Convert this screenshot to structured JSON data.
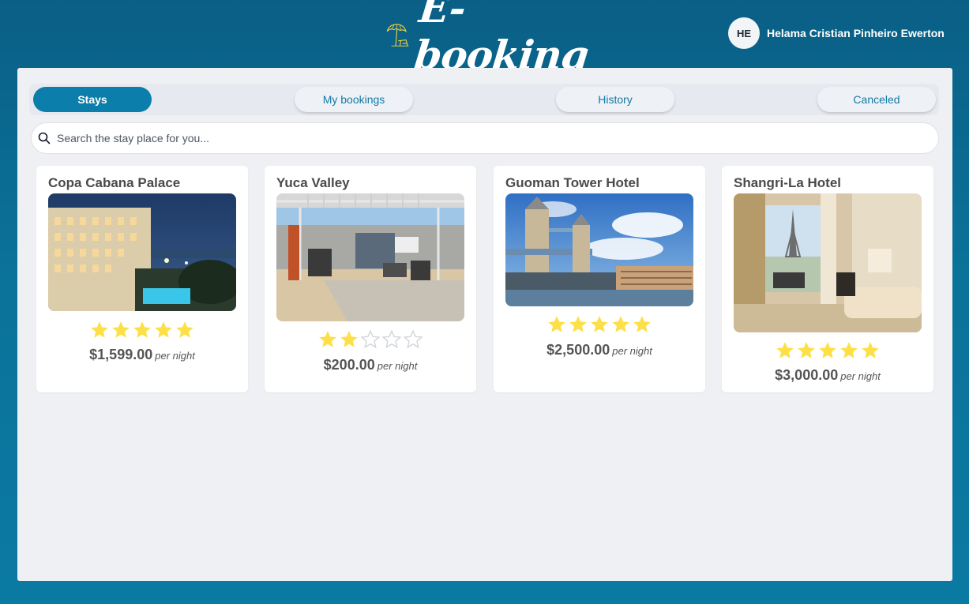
{
  "app": {
    "logo_text": "E-booking"
  },
  "user": {
    "initials": "HE",
    "name": "Helama Cristian Pinheiro Ewerton"
  },
  "tabs": [
    {
      "label": "Stays",
      "active": true
    },
    {
      "label": "My bookings",
      "active": false
    },
    {
      "label": "History",
      "active": false
    },
    {
      "label": "Canceled",
      "active": false
    }
  ],
  "search": {
    "placeholder": "Search the stay place for you...",
    "value": ""
  },
  "stays": [
    {
      "name": "Copa Cabana Palace",
      "rating": 5,
      "max_rating": 5,
      "price": "$1,599.00",
      "price_unit": "per night",
      "image": "hotel-night-pool-photo"
    },
    {
      "name": "Yuca Valley",
      "rating": 2,
      "max_rating": 5,
      "price": "$200.00",
      "price_unit": "per night",
      "image": "backyard-pergola-photo"
    },
    {
      "name": "Guoman Tower Hotel",
      "rating": 5,
      "max_rating": 5,
      "price": "$2,500.00",
      "price_unit": "per night",
      "image": "tower-bridge-photo"
    },
    {
      "name": "Shangri-La Hotel",
      "rating": 5,
      "max_rating": 5,
      "price": "$3,000.00",
      "price_unit": "per night",
      "image": "eiffel-view-room-photo"
    }
  ],
  "colors": {
    "accent": "#0c7eab",
    "star_filled": "#fde047",
    "star_empty": "#d1d5db"
  }
}
